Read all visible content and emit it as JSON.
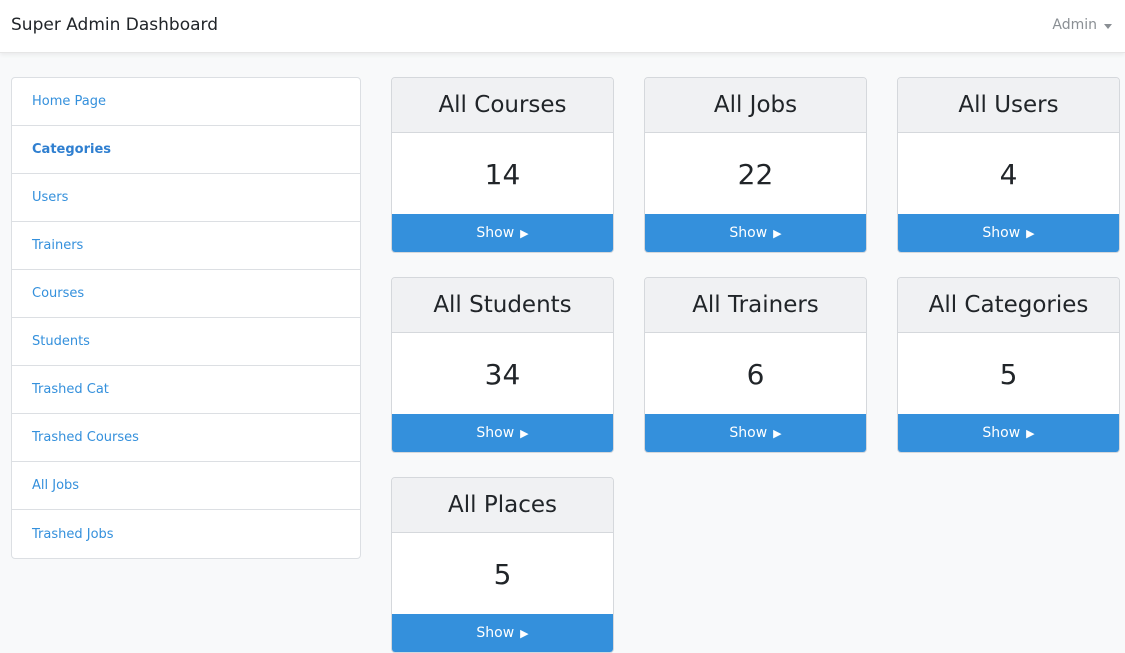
{
  "navbar": {
    "brand": "Super Admin Dashboard",
    "user": "Admin"
  },
  "sidebar": {
    "items": [
      {
        "label": "Home Page",
        "active": false
      },
      {
        "label": "Categories",
        "active": true
      },
      {
        "label": "Users",
        "active": false
      },
      {
        "label": "Trainers",
        "active": false
      },
      {
        "label": "Courses",
        "active": false
      },
      {
        "label": "Students",
        "active": false
      },
      {
        "label": "Trashed Cat",
        "active": false
      },
      {
        "label": "Trashed Courses",
        "active": false
      },
      {
        "label": "All Jobs",
        "active": false
      },
      {
        "label": "Trashed Jobs",
        "active": false
      }
    ]
  },
  "cards": [
    {
      "title": "All Courses",
      "count": "14",
      "button": "Show"
    },
    {
      "title": "All Jobs",
      "count": "22",
      "button": "Show"
    },
    {
      "title": "All Users",
      "count": "4",
      "button": "Show"
    },
    {
      "title": "All Students",
      "count": "34",
      "button": "Show"
    },
    {
      "title": "All Trainers",
      "count": "6",
      "button": "Show"
    },
    {
      "title": "All Categories",
      "count": "5",
      "button": "Show"
    },
    {
      "title": "All Places",
      "count": "5",
      "button": "Show"
    }
  ],
  "colors": {
    "accent": "#3490dc",
    "background": "#f8f9fa",
    "card_header": "#f0f1f3"
  }
}
